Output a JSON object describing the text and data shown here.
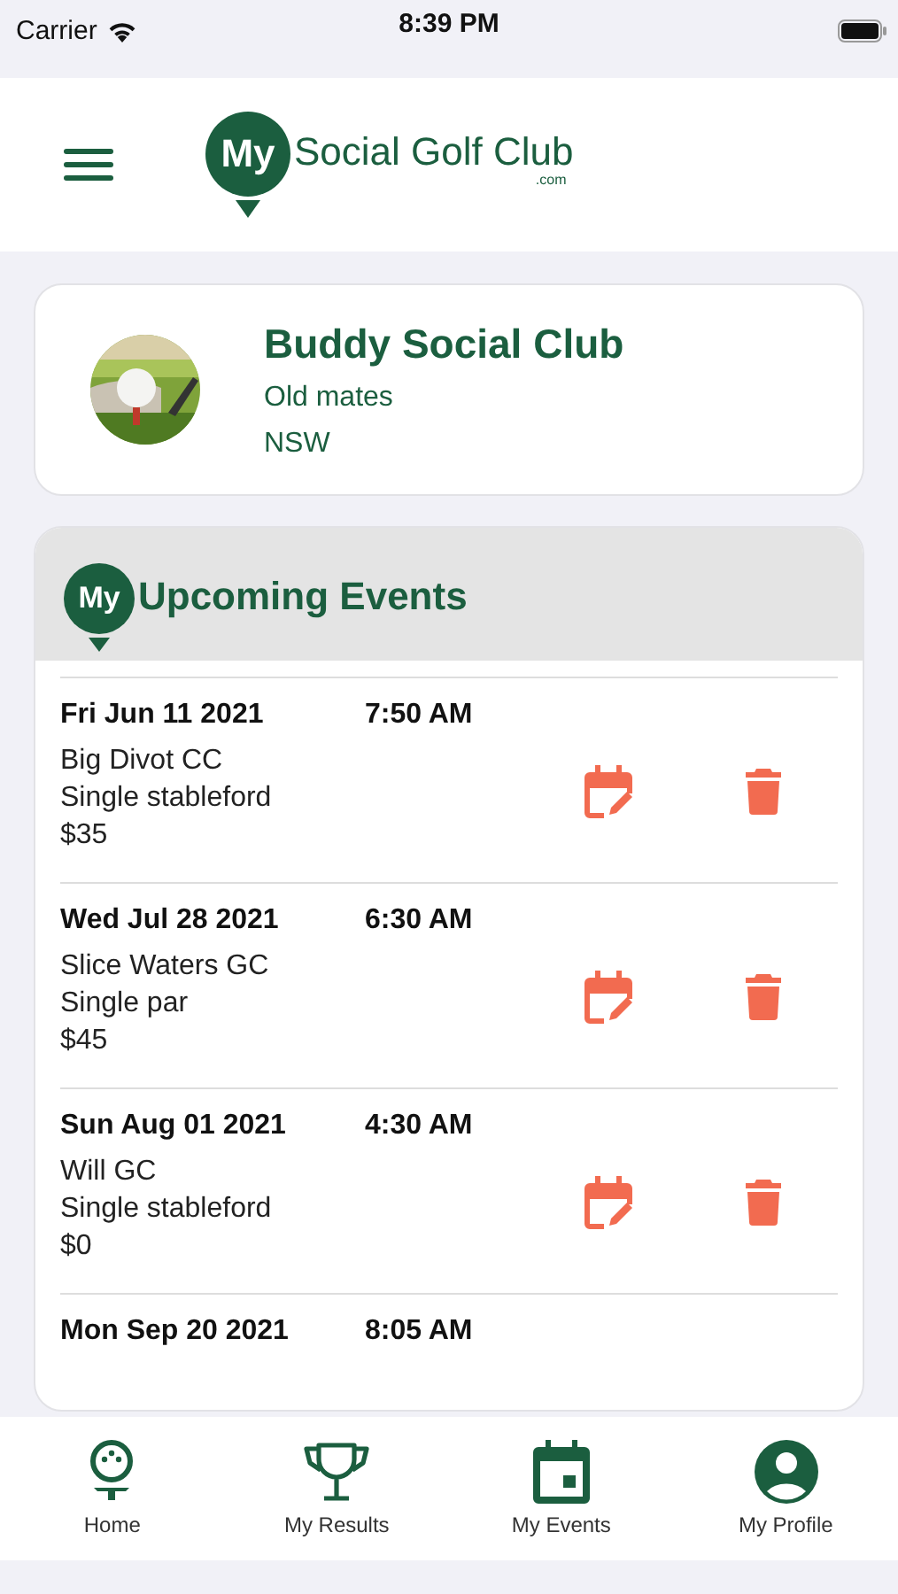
{
  "status_bar": {
    "carrier": "Carrier",
    "time": "8:39 PM"
  },
  "header": {
    "logo_mark": "My",
    "logo_text": "Social Golf Club",
    "logo_suffix": ".com"
  },
  "club": {
    "name": "Buddy Social Club",
    "description": "Old mates",
    "state": "NSW"
  },
  "events_section": {
    "badge": "My",
    "title": "Upcoming Events"
  },
  "events": [
    {
      "date": "Fri Jun 11 2021",
      "time": "7:50 AM",
      "course": "Big Divot CC",
      "format": "Single stableford",
      "fee": "$35"
    },
    {
      "date": "Wed Jul 28 2021",
      "time": "6:30 AM",
      "course": "Slice Waters GC",
      "format": "Single par",
      "fee": "$45"
    },
    {
      "date": "Sun Aug 01 2021",
      "time": "4:30 AM",
      "course": "Will GC",
      "format": "Single stableford",
      "fee": "$0"
    },
    {
      "date": "Mon Sep 20 2021",
      "time": "8:05 AM"
    }
  ],
  "tab_bar": [
    {
      "label": "Home",
      "kind": "home"
    },
    {
      "label": "My Results",
      "kind": "results"
    },
    {
      "label": "My Events",
      "kind": "events"
    },
    {
      "label": "My Profile",
      "kind": "profile"
    }
  ]
}
